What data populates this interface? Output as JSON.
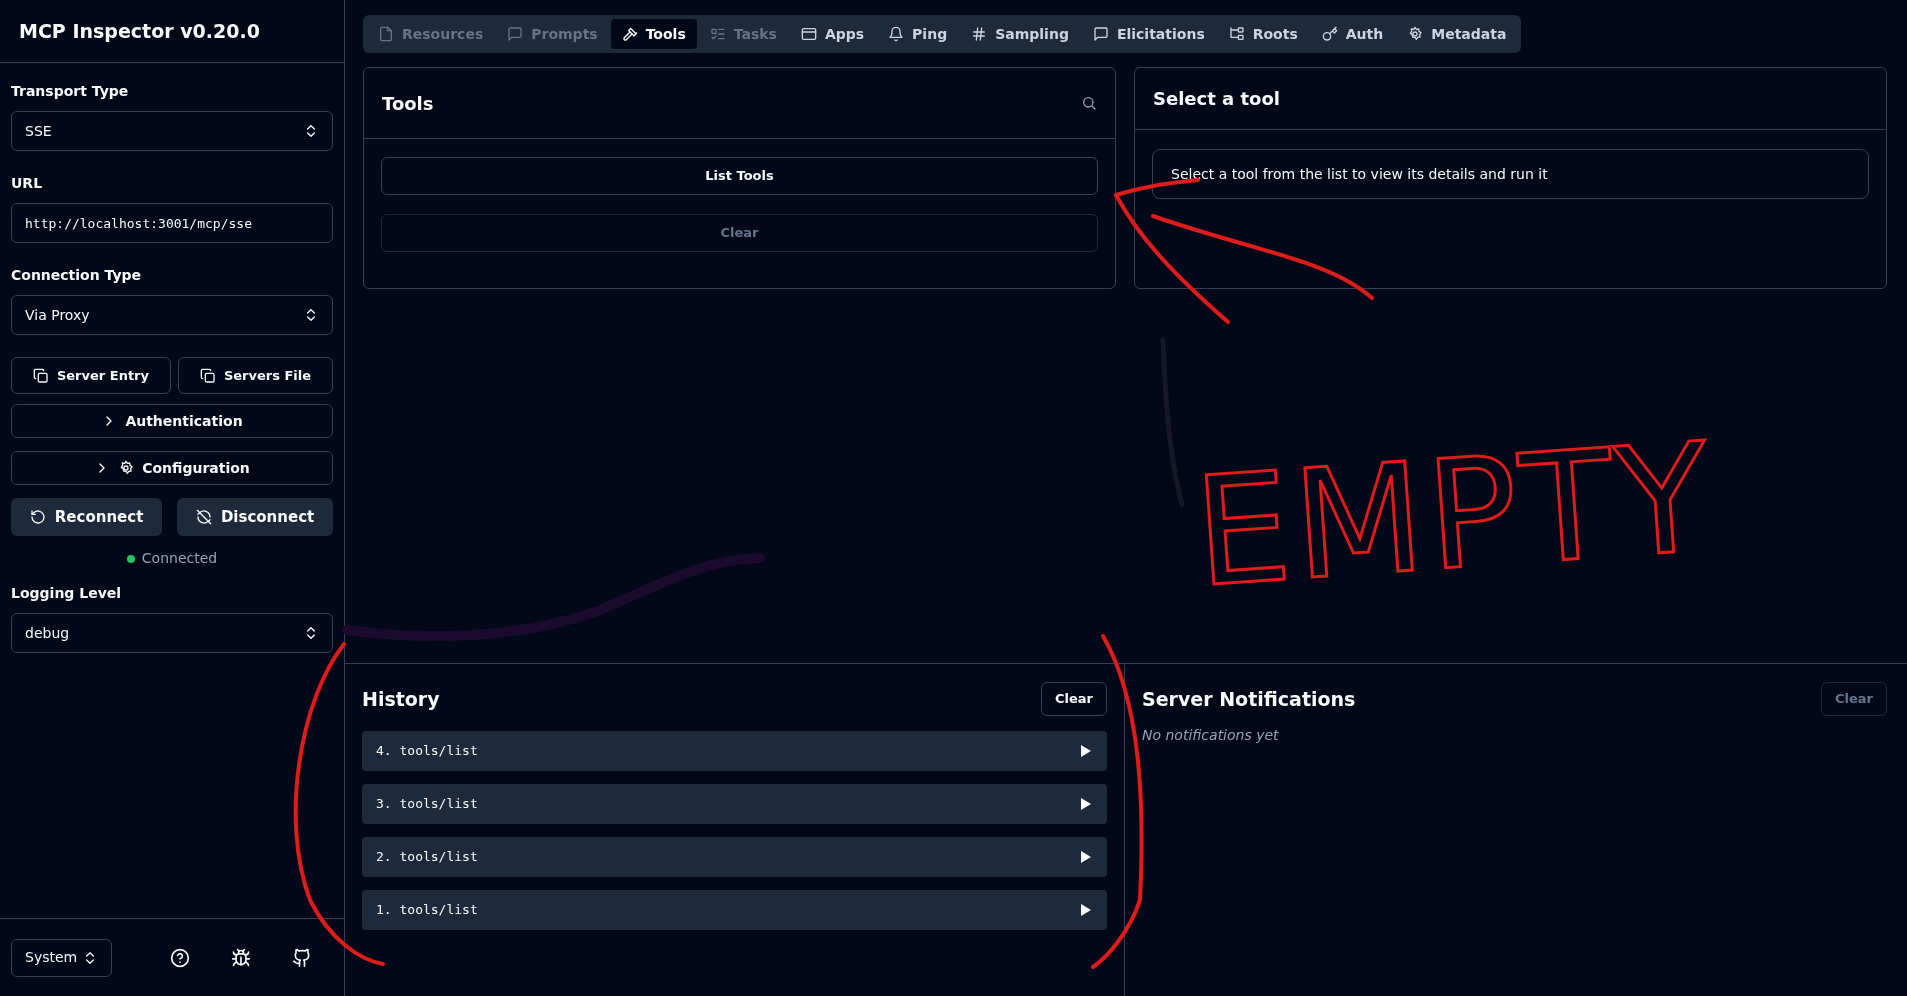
{
  "app": {
    "title": "MCP Inspector v0.20.0"
  },
  "sidebar": {
    "fields": [
      {
        "kind": "select",
        "label": "Transport Type",
        "value": "SSE"
      },
      {
        "kind": "input",
        "label": "URL",
        "value": "http://localhost:3001/mcp/sse"
      },
      {
        "kind": "select",
        "label": "Connection Type",
        "value": "Via Proxy"
      }
    ],
    "copy_buttons": [
      "Server Entry",
      "Servers File"
    ],
    "sections": [
      {
        "kind": "plain",
        "label": "Authentication",
        "expanded": false
      },
      {
        "kind": "settings",
        "label": "Configuration",
        "expanded": false
      }
    ],
    "actions": [
      "Reconnect",
      "Disconnect"
    ],
    "status": {
      "text": "Connected",
      "connected": true
    },
    "logging": {
      "label": "Logging Level",
      "value": "debug"
    },
    "theme_select": {
      "value": "System"
    }
  },
  "tabs": [
    {
      "label": "Resources",
      "selected": false,
      "disabled": true
    },
    {
      "label": "Prompts",
      "selected": false,
      "disabled": true
    },
    {
      "label": "Tools",
      "selected": true,
      "disabled": false
    },
    {
      "label": "Tasks",
      "selected": false,
      "disabled": true
    },
    {
      "label": "Apps",
      "selected": false,
      "disabled": false
    },
    {
      "label": "Ping",
      "selected": false,
      "disabled": false
    },
    {
      "label": "Sampling",
      "selected": false,
      "disabled": false
    },
    {
      "label": "Elicitations",
      "selected": false,
      "disabled": false
    },
    {
      "label": "Roots",
      "selected": false,
      "disabled": false
    },
    {
      "label": "Auth",
      "selected": false,
      "disabled": false
    },
    {
      "label": "Metadata",
      "selected": false,
      "disabled": false
    }
  ],
  "tools_panel": {
    "title": "Tools",
    "buttons": [
      {
        "label": "List Tools",
        "disabled": false
      },
      {
        "label": "Clear",
        "disabled": true
      }
    ]
  },
  "detail_panel": {
    "title": "Select a tool",
    "message": "Select a tool from the list to view its details and run it"
  },
  "history": {
    "title": "History",
    "clear_button": {
      "label": "Clear",
      "disabled": false
    },
    "items": [
      {
        "text": "4. tools/list",
        "expanded": false
      },
      {
        "text": "3. tools/list",
        "expanded": false
      },
      {
        "text": "2. tools/list",
        "expanded": false
      },
      {
        "text": "1. tools/list",
        "expanded": false
      }
    ]
  },
  "notifications": {
    "title": "Server Notifications",
    "clear_button": {
      "label": "Clear",
      "disabled": true
    },
    "empty_text": "No notifications yet"
  },
  "annotation": {
    "text": "EMPTY"
  }
}
